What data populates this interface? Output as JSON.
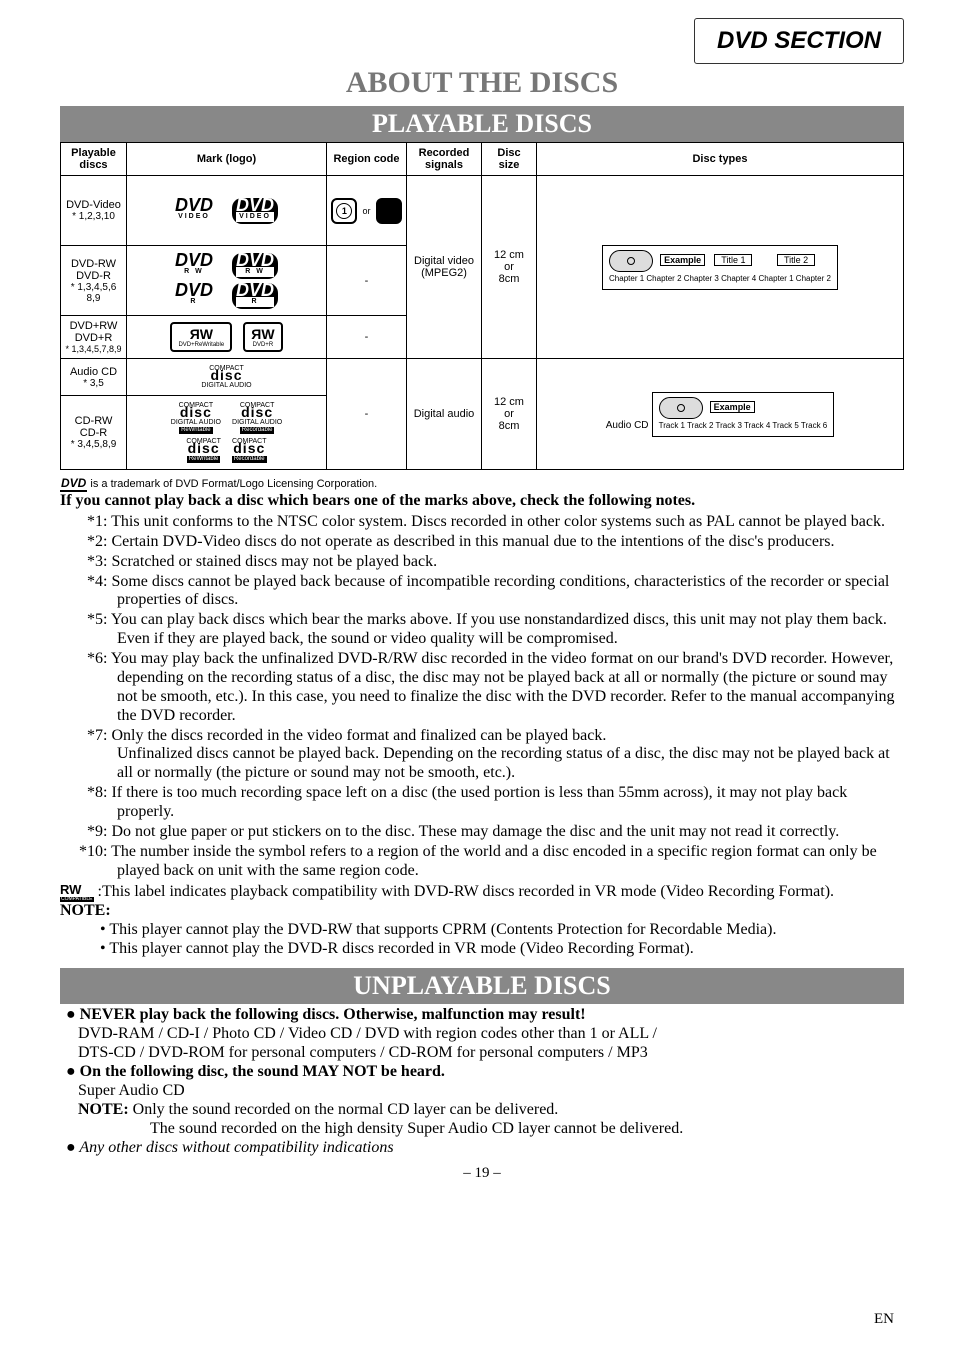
{
  "section_tab": "DVD SECTION",
  "main_title": "ABOUT THE DISCS",
  "band_playable": "PLAYABLE DISCS",
  "band_unplayable": "UNPLAYABLE DISCS",
  "table": {
    "headers": {
      "playable": "Playable discs",
      "mark": "Mark (logo)",
      "region": "Region code",
      "recorded": "Recorded signals",
      "size": "Disc size",
      "types": "Disc types"
    },
    "rows": {
      "dvd_video": {
        "name": "DVD-Video",
        "note": "* 1,2,3,10"
      },
      "dvd_rw_r": {
        "name": "DVD-RW\nDVD-R",
        "note": "* 1,3,4,5,6\n8,9"
      },
      "dvd_plus": {
        "name": "DVD+RW\nDVD+R",
        "note": "* 1,3,4,5,7,8,9"
      },
      "audio_cd": {
        "name": "Audio CD",
        "note": "* 3,5"
      },
      "cd_rw_r": {
        "name": "CD-RW\nCD-R",
        "note": "* 3,4,5,8,9"
      }
    },
    "region_or": "or",
    "region_num1": "1",
    "rec_video": "Digital video\n(MPEG2)",
    "rec_audio": "Digital audio",
    "size1": "12 cm\nor\n8cm",
    "size2": "12 cm\nor\n8cm",
    "example_label": "Example",
    "title1": "Title 1",
    "title2": "Title 2",
    "chapters": "Chapter 1 Chapter 2 Chapter 3 Chapter 4   Chapter 1 Chapter 2",
    "audio_cd_tag": "Audio CD",
    "tracks": "Track 1   Track 2   Track 3   Track 4   Track 5   Track 6"
  },
  "logos": {
    "dvd": "DVD",
    "video_sub": "VIDEO",
    "rw_sub": "R W",
    "r_sub": "R",
    "rw_plus_a": "DVD+ReWritable",
    "rw_plus_b": "DVD+R",
    "compact": "COMPACT",
    "disc": "disc",
    "digaudio": "DIGITAL AUDIO",
    "rewritable": "ReWritable",
    "recordable": "Recordable"
  },
  "trademark_text": " is a trademark of DVD Format/Logo Licensing Corporation.",
  "intro_bold": "If you cannot play back a disc which bears one of the marks above, check the following notes.",
  "notes": [
    "*1: This unit conforms to the NTSC color system. Discs recorded in other color systems such as PAL cannot be played back.",
    "*2: Certain DVD-Video discs do not operate as described in this manual due to the intentions of the disc's producers.",
    "*3: Scratched or stained discs may not be played back.",
    "*4: Some discs cannot be played back because of incompatible recording conditions, characteristics of the recorder or special properties of discs.",
    "*5: You can play back discs which bear the marks above. If you use nonstandardized discs, this unit may not play them back. Even if they are played back, the sound or video quality will be compromised.",
    "*6: You may play back the unfinalized DVD-R/RW disc recorded in the video format on our brand's DVD recorder. However, depending on the recording status of a disc, the disc may not be played back at all or normally (the picture or sound may not be smooth, etc.). In this case, you need to finalize the disc with the DVD recorder. Refer to the manual accompanying the DVD recorder.",
    "*7: Only the discs recorded in the video format and finalized can be played back.\nUnfinalized discs cannot be played back. Depending on the recording status of a disc, the disc may not be played back at all or normally (the picture or sound may not be smooth, etc.).",
    "*8: If there is too much recording space left on a disc (the used portion is less than 55mm across), it may not play back properly.",
    "*9: Do not glue paper or put stickers on to the disc. These may damage the disc and the unit may not read it correctly.",
    "*10: The number inside the symbol refers to a region of the world and a disc encoded in a specific region format can only be played back on unit with the same region code."
  ],
  "rw_text": " :This label indicates playback compatibility with DVD-RW discs recorded in VR mode (Video Recording Format).",
  "rw_mark": "RW",
  "rw_compat": "COMPATIBLE",
  "note_head": "NOTE:",
  "note_a": "• This player cannot play the DVD-RW that supports CPRM (Contents Protection for Recordable Media).",
  "note_b": "• This player cannot play the DVD-R discs recorded in VR mode (Video Recording Format).",
  "unplay": {
    "b1": "NEVER play back the following discs. Otherwise, malfunction may result!",
    "l1": "DVD-RAM / CD-I / Photo CD / Video CD / DVD with region codes other than 1 or ALL /",
    "l2": "DTS-CD / DVD-ROM for personal computers / CD-ROM for personal computers / MP3",
    "b2": "On the following disc, the sound MAY NOT be heard.",
    "l3": "Super Audio CD",
    "l4_lead": "NOTE:",
    "l4": " Only the sound recorded on the normal CD layer can be delivered.",
    "l5": "The sound recorded on the high density Super Audio CD layer cannot be delivered.",
    "l6": "Any other discs without compatibility indications"
  },
  "page_num": "– 19 –",
  "page_lang": "EN"
}
